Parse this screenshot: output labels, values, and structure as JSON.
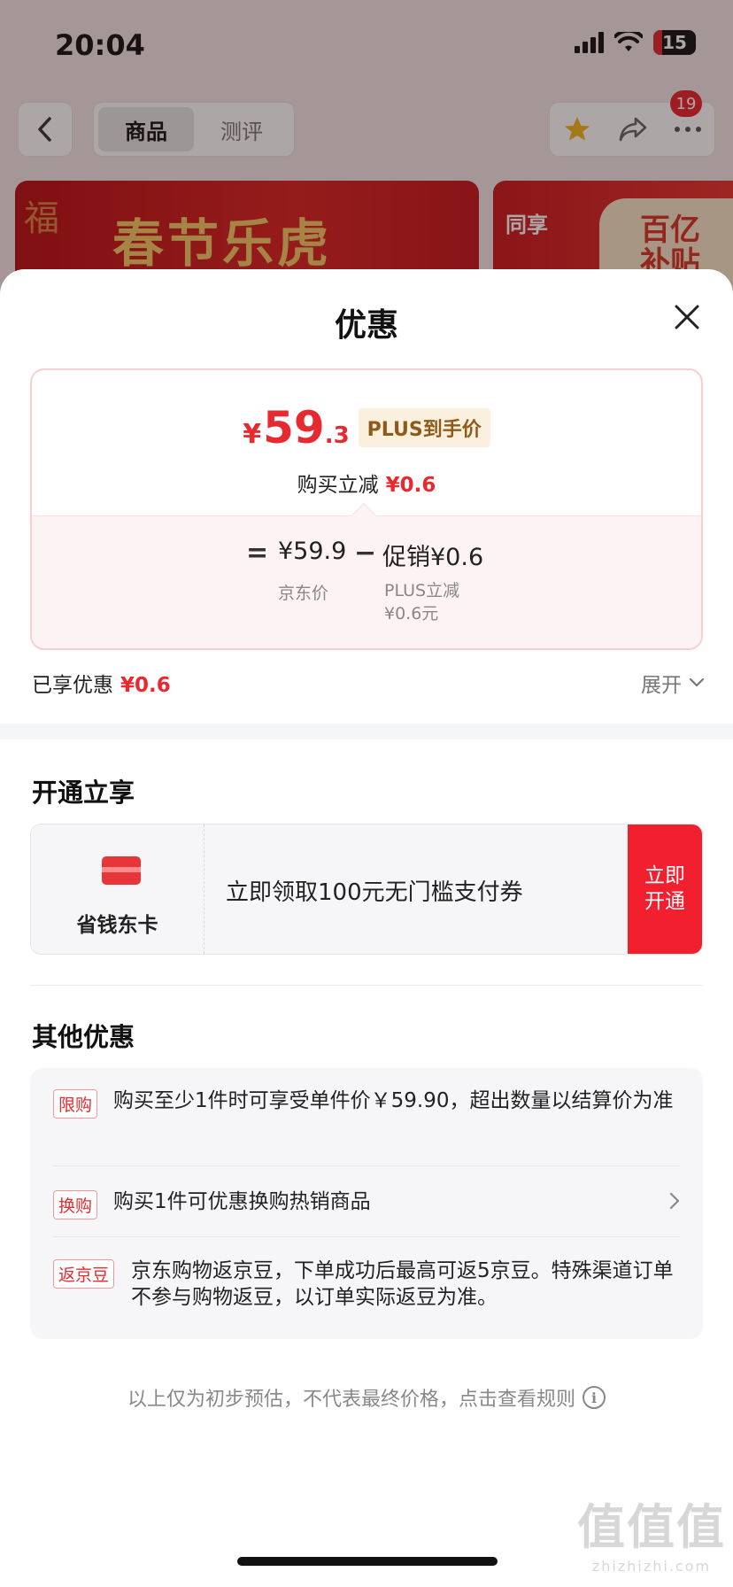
{
  "status_bar": {
    "time": "20:04",
    "battery": "15"
  },
  "nav": {
    "tabs": [
      {
        "label": "商品",
        "active": true
      },
      {
        "label": "测评",
        "active": false
      }
    ],
    "badge_count": "19"
  },
  "banners": {
    "left_text": "春节乐虎",
    "right_text_a": "同享",
    "right_text_b": "百亿",
    "right_text_c": "补贴"
  },
  "sheet": {
    "title": "优惠",
    "price": {
      "currency": "¥",
      "integer": "59",
      "decimal": ".3",
      "tag": "PLUS到手价",
      "reduce_label": "购买立减",
      "reduce_value": "¥0.6",
      "eq": "=",
      "base_value": "¥59.9",
      "base_label": "京东价",
      "minus": "−",
      "promo_value": "促销¥0.6",
      "promo_label_1": "PLUS立减",
      "promo_label_2": "¥0.6元"
    },
    "enjoyed": {
      "label": "已享优惠",
      "value": "¥0.6",
      "expand": "展开"
    },
    "open_section": {
      "title": "开通立享",
      "card_name": "省钱东卡",
      "desc": "立即领取100元无门槛支付券",
      "button_line1": "立即",
      "button_line2": "开通"
    },
    "other_section": {
      "title": "其他优惠",
      "items": [
        {
          "tag": "限购",
          "text": "购买至少1件时可享受单件价￥59.90，超出数量以结算价为准"
        },
        {
          "tag": "换购",
          "text": "购买1件可优惠换购热销商品"
        },
        {
          "tag": "返京豆",
          "text": "京东购物返京豆，下单成功后最高可返5京豆。特殊渠道订单不参与购物返豆，以订单实际返豆为准。"
        }
      ]
    },
    "footer_note": "以上仅为初步预估，不代表最终价格，点击查看规则"
  },
  "watermark": {
    "big": "值值值",
    "small": "zhizhizhi.com"
  },
  "colors": {
    "accent": "#e62a2f",
    "button_red": "#f21f2f",
    "plus_gold": "#8e5a1c"
  }
}
